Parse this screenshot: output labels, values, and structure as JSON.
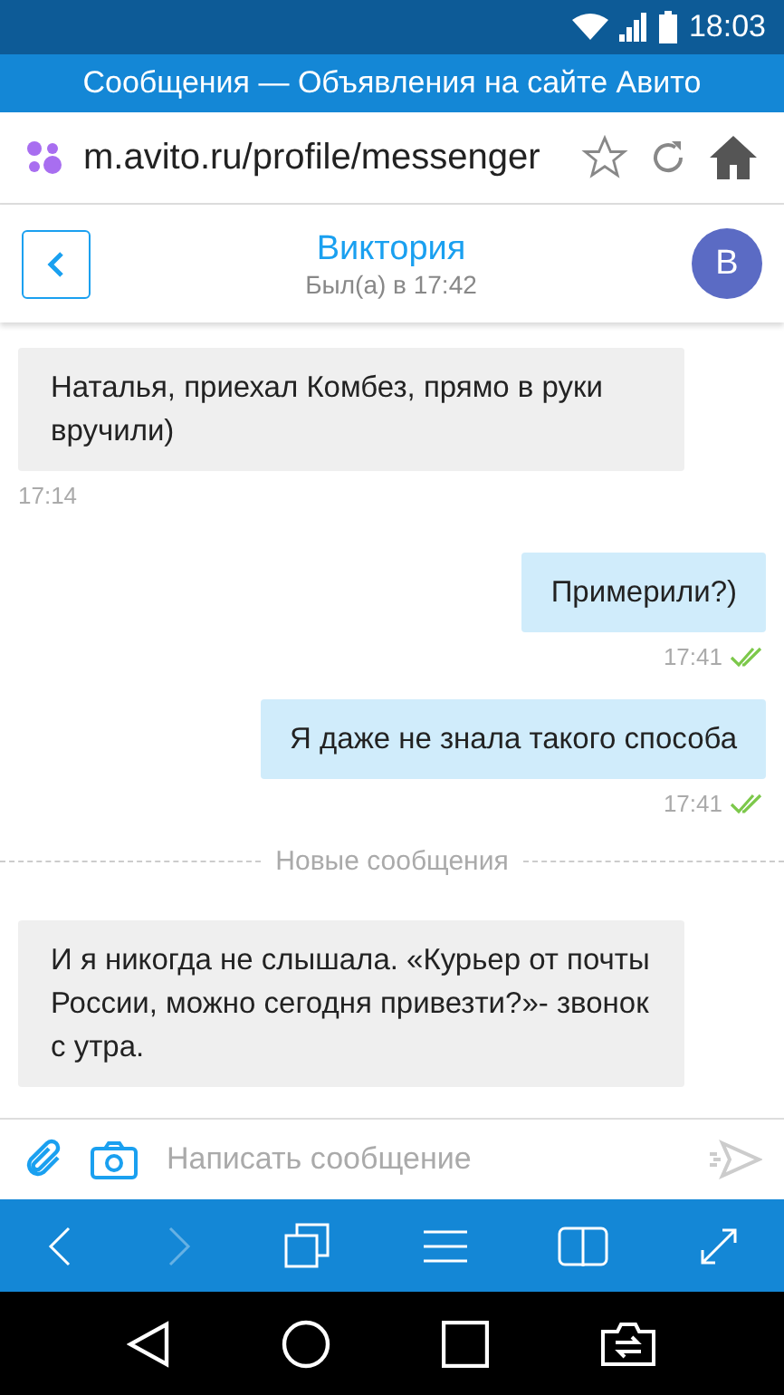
{
  "status_bar": {
    "time": "18:03"
  },
  "browser": {
    "page_title": "Сообщения — Объявления на сайте Авито",
    "url": "m.avito.ru/profile/messenger"
  },
  "chat_header": {
    "name": "Виктория",
    "last_seen": "Был(а) в 17:42",
    "avatar_letter": "В"
  },
  "messages": [
    {
      "kind": "incoming",
      "text": "Наталья, приехал Комбез, прямо в руки вручили)",
      "time": "17:14"
    },
    {
      "kind": "outgoing",
      "text": "Примерили?)",
      "time": "17:41",
      "read": true
    },
    {
      "kind": "outgoing",
      "text": "Я даже не знала такого способа",
      "time": "17:41",
      "read": true
    },
    {
      "kind": "divider",
      "text": "Новые сообщения"
    },
    {
      "kind": "incoming",
      "text": "И я никогда не слышала. «Курьер от почты России, можно сегодня привезти?»- звонок с утра."
    }
  ],
  "composer": {
    "placeholder": "Написать сообщение"
  },
  "toolbar": {
    "forward_disabled": true
  }
}
